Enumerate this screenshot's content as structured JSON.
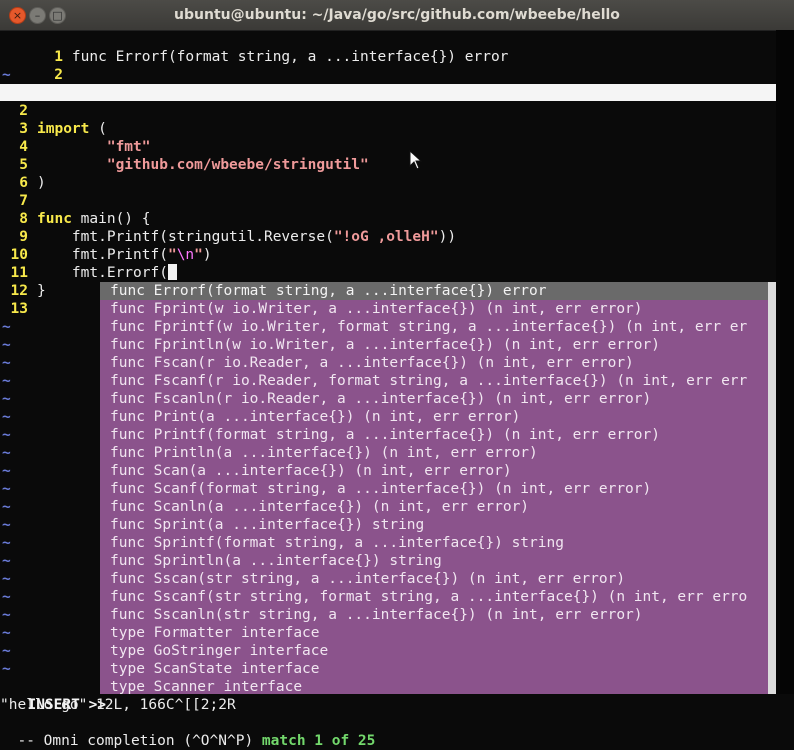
{
  "window": {
    "title": "ubuntu@ubuntu: ~/Java/go/src/github.com/wbeebe/hello",
    "close_glyph": "×",
    "min_glyph": "–",
    "max_glyph": "□"
  },
  "preview": {
    "line1_num": "1",
    "line1_text": "func Errorf(format string, a ...interface{}) error",
    "line2_num": "2",
    "tilde": "~"
  },
  "code": {
    "lines": [
      {
        "num": "2"
      },
      {
        "num": "3",
        "kw": "import",
        "rest": " ("
      },
      {
        "num": "4",
        "indent": "        ",
        "str": "\"fmt\""
      },
      {
        "num": "5",
        "indent": "        ",
        "str": "\"github.com/wbeebe/stringutil\""
      },
      {
        "num": "6",
        "rest": ")"
      },
      {
        "num": "7"
      },
      {
        "num": "8",
        "kw": "func",
        "rest": " main() {"
      },
      {
        "num": "9",
        "indent": "    ",
        "pre": "fmt.Printf(stringutil.Reverse(",
        "str": "\"!oG ,olleH\"",
        "post": "))"
      },
      {
        "num": "10",
        "indent": "    ",
        "pre": "fmt.Printf(",
        "q1": "\"",
        "esc": "\\n",
        "q2": "\"",
        "post": ")"
      },
      {
        "num": "11",
        "indent": "    ",
        "pre": "fmt.Errorf("
      },
      {
        "num": "12",
        "rest": "}"
      },
      {
        "num": "13"
      }
    ],
    "tilde": "~"
  },
  "completion": {
    "items": [
      "func Errorf(format string, a ...interface{}) error",
      "func Fprint(w io.Writer, a ...interface{}) (n int, err error)",
      "func Fprintf(w io.Writer, format string, a ...interface{}) (n int, err er",
      "func Fprintln(w io.Writer, a ...interface{}) (n int, err error)",
      "func Fscan(r io.Reader, a ...interface{}) (n int, err error)",
      "func Fscanf(r io.Reader, format string, a ...interface{}) (n int, err err",
      "func Fscanln(r io.Reader, a ...interface{}) (n int, err error)",
      "func Print(a ...interface{}) (n int, err error)",
      "func Printf(format string, a ...interface{}) (n int, err error)",
      "func Println(a ...interface{}) (n int, err error)",
      "func Scan(a ...interface{}) (n int, err error)",
      "func Scanf(format string, a ...interface{}) (n int, err error)",
      "func Scanln(a ...interface{}) (n int, err error)",
      "func Sprint(a ...interface{}) string",
      "func Sprintf(format string, a ...interface{}) string",
      "func Sprintln(a ...interface{}) string",
      "func Sscan(str string, a ...interface{}) (n int, err error)",
      "func Sscanf(str string, format string, a ...interface{}) (n int, err erro",
      "func Sscanln(str string, a ...interface{}) (n int, err error)",
      "type Formatter interface",
      "type GoStringer interface",
      "type ScanState interface",
      "type Scanner interface"
    ],
    "selected_index": 0
  },
  "status": {
    "mode_line": "INSERT >>",
    "file_info": "\"hello.go\" 12L, 166C^[[2;2R",
    "omni_prefix": "-- Omni completion (^O^N^P) ",
    "match_text": "match 1 of 25"
  },
  "colors": {
    "linenum": "#f8e94b",
    "keyword": "#f8e94b",
    "string": "#ef9a9a",
    "tilde": "#6a7bd8",
    "popup_bg": "#8b538c",
    "popup_selected_bg": "#6a6a6a",
    "match": "#73d86c"
  }
}
